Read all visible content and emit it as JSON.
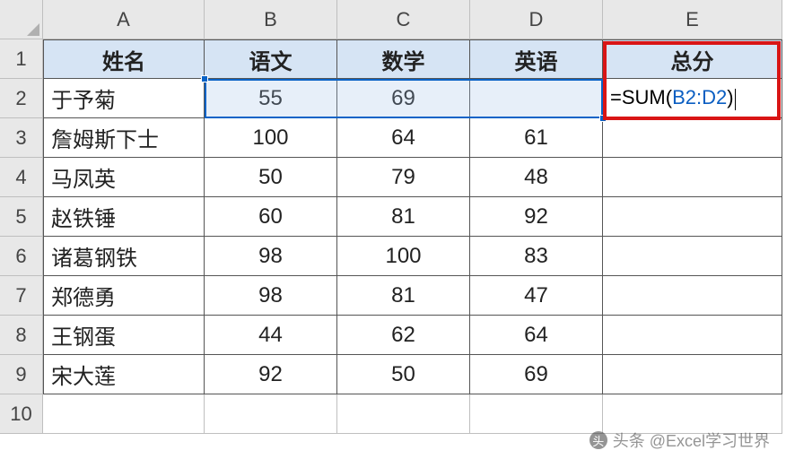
{
  "columns": [
    "A",
    "B",
    "C",
    "D",
    "E"
  ],
  "row_numbers": [
    "1",
    "2",
    "3",
    "4",
    "5",
    "6",
    "7",
    "8",
    "9",
    "10"
  ],
  "headers": {
    "A": "姓名",
    "B": "语文",
    "C": "数学",
    "D": "英语",
    "E": "总分"
  },
  "rows": [
    {
      "name": "于予菊",
      "chinese": "55",
      "math": "69",
      "english": "",
      "total": ""
    },
    {
      "name": "詹姆斯下士",
      "chinese": "100",
      "math": "64",
      "english": "61",
      "total": ""
    },
    {
      "name": "马凤英",
      "chinese": "50",
      "math": "79",
      "english": "48",
      "total": ""
    },
    {
      "name": "赵铁锤",
      "chinese": "60",
      "math": "81",
      "english": "92",
      "total": ""
    },
    {
      "name": "诸葛钢铁",
      "chinese": "98",
      "math": "100",
      "english": "83",
      "total": ""
    },
    {
      "name": "郑德勇",
      "chinese": "98",
      "math": "81",
      "english": "47",
      "total": ""
    },
    {
      "name": "王钢蛋",
      "chinese": "44",
      "math": "62",
      "english": "64",
      "total": ""
    },
    {
      "name": "宋大莲",
      "chinese": "92",
      "math": "50",
      "english": "69",
      "total": ""
    }
  ],
  "formula": {
    "prefix": "=SUM(",
    "ref": "B2:D2",
    "suffix": ")"
  },
  "watermark": "头条 @Excel学习世界",
  "chart_data": {
    "type": "table",
    "columns": [
      "姓名",
      "语文",
      "数学",
      "英语",
      "总分"
    ],
    "rows": [
      [
        "于予菊",
        55,
        69,
        null,
        "=SUM(B2:D2)"
      ],
      [
        "詹姆斯下士",
        100,
        64,
        61,
        null
      ],
      [
        "马凤英",
        50,
        79,
        48,
        null
      ],
      [
        "赵铁锤",
        60,
        81,
        92,
        null
      ],
      [
        "诸葛钢铁",
        98,
        100,
        83,
        null
      ],
      [
        "郑德勇",
        98,
        81,
        47,
        null
      ],
      [
        "王钢蛋",
        44,
        62,
        64,
        null
      ],
      [
        "宋大莲",
        92,
        50,
        69,
        null
      ]
    ]
  }
}
